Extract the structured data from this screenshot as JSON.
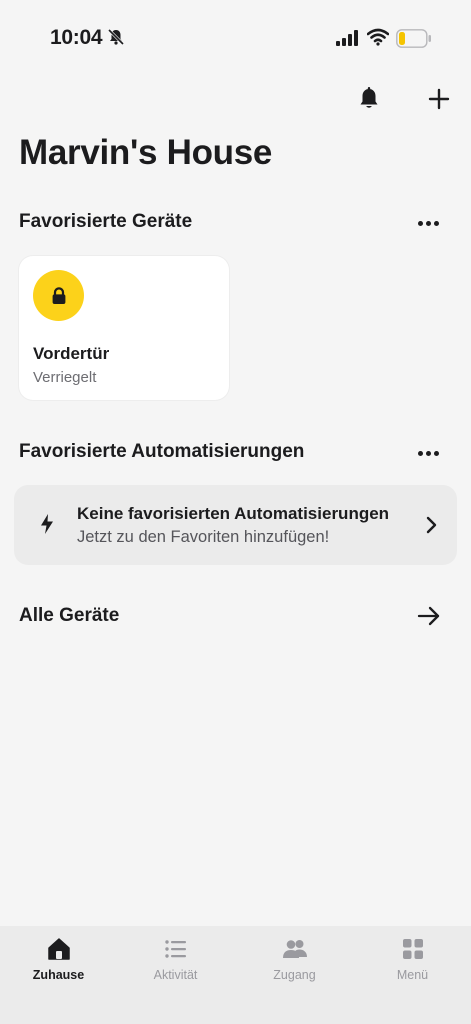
{
  "status_bar": {
    "time": "10:04",
    "battery_color": "#f5c400"
  },
  "header": {
    "title": "Marvin's House"
  },
  "favorites_devices": {
    "section_title": "Favorisierte Geräte",
    "devices": [
      {
        "name": "Vordertür",
        "status": "Verriegelt",
        "icon": "lock-icon",
        "icon_bg": "#fcd21a"
      }
    ]
  },
  "favorites_automations": {
    "section_title": "Favorisierte Automatisierungen",
    "empty_title": "Keine favorisierten Automatisierungen",
    "empty_subtitle": "Jetzt zu den Favoriten hinzufügen!"
  },
  "all_devices": {
    "title": "Alle Geräte"
  },
  "tab_bar": {
    "tabs": [
      {
        "label": "Zuhause",
        "icon": "home-icon",
        "active": true
      },
      {
        "label": "Aktivität",
        "icon": "list-icon",
        "active": false
      },
      {
        "label": "Zugang",
        "icon": "people-icon",
        "active": false
      },
      {
        "label": "Menü",
        "icon": "grid-icon",
        "active": false
      }
    ]
  }
}
